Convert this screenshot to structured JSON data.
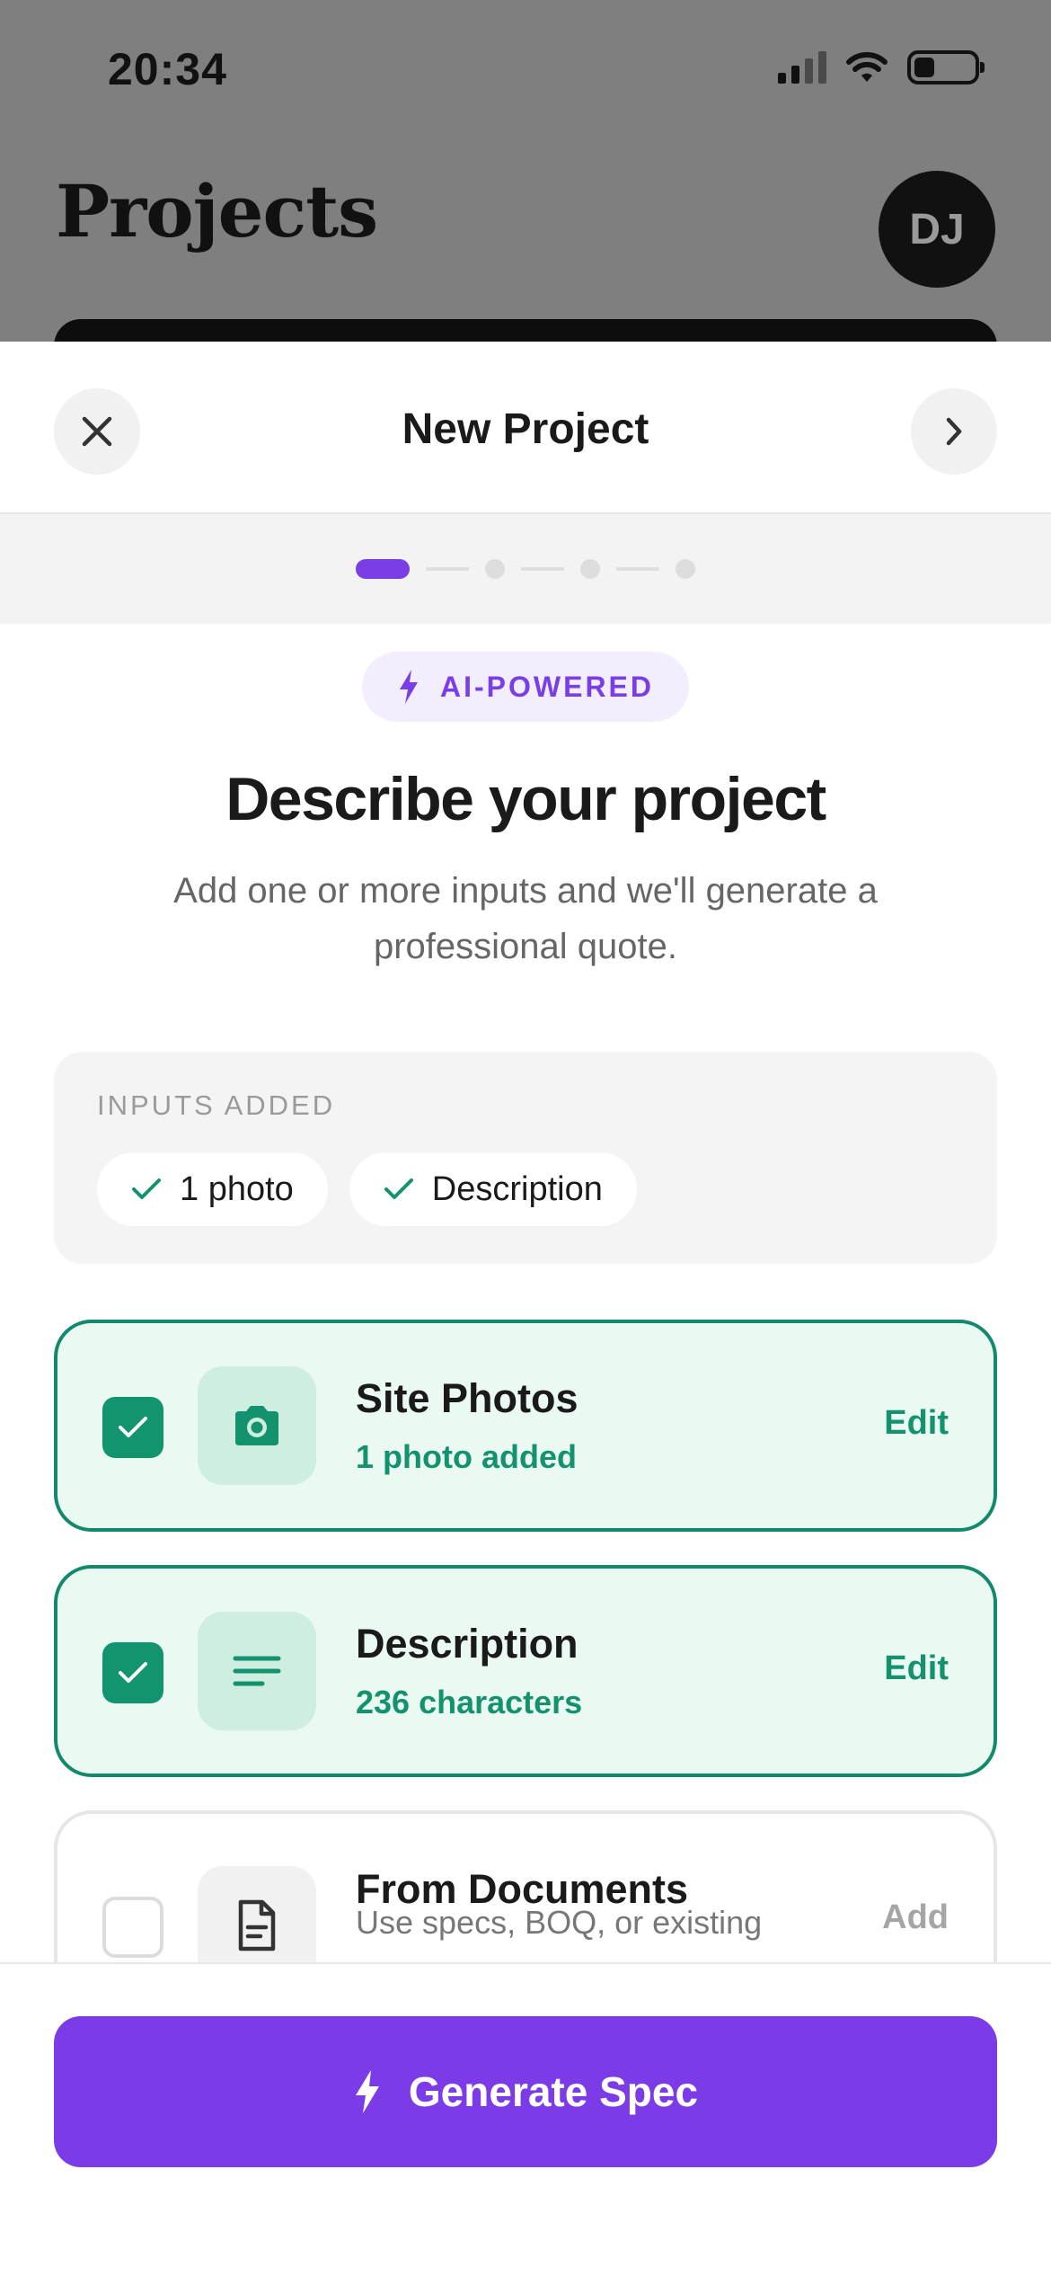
{
  "status_bar": {
    "time": "20:34"
  },
  "background": {
    "title": "Projects",
    "avatar_initials": "DJ"
  },
  "sheet": {
    "title": "New Project",
    "stepper": {
      "total_steps": 4,
      "current_step": 1
    },
    "badge": "AI-POWERED",
    "heading": "Describe your project",
    "subtext": "Add one or more inputs and we'll generate a professional quote.",
    "inputs_added": {
      "label": "INPUTS ADDED",
      "chips": [
        "1 photo",
        "Description"
      ]
    },
    "cards": [
      {
        "title": "Site Photos",
        "subtitle": "1 photo added",
        "action": "Edit",
        "checked": true,
        "icon": "camera-icon"
      },
      {
        "title": "Description",
        "subtitle": "236 characters",
        "action": "Edit",
        "checked": true,
        "icon": "text-lines-icon"
      },
      {
        "title": "From Documents",
        "subtitle": "Use specs, BOQ, or existing",
        "action": "Add",
        "checked": false,
        "icon": "document-icon"
      }
    ],
    "primary_button": "Generate Spec"
  },
  "colors": {
    "accent": "#7b3be6",
    "success": "#12946f",
    "success_bg": "#eafaf2"
  }
}
